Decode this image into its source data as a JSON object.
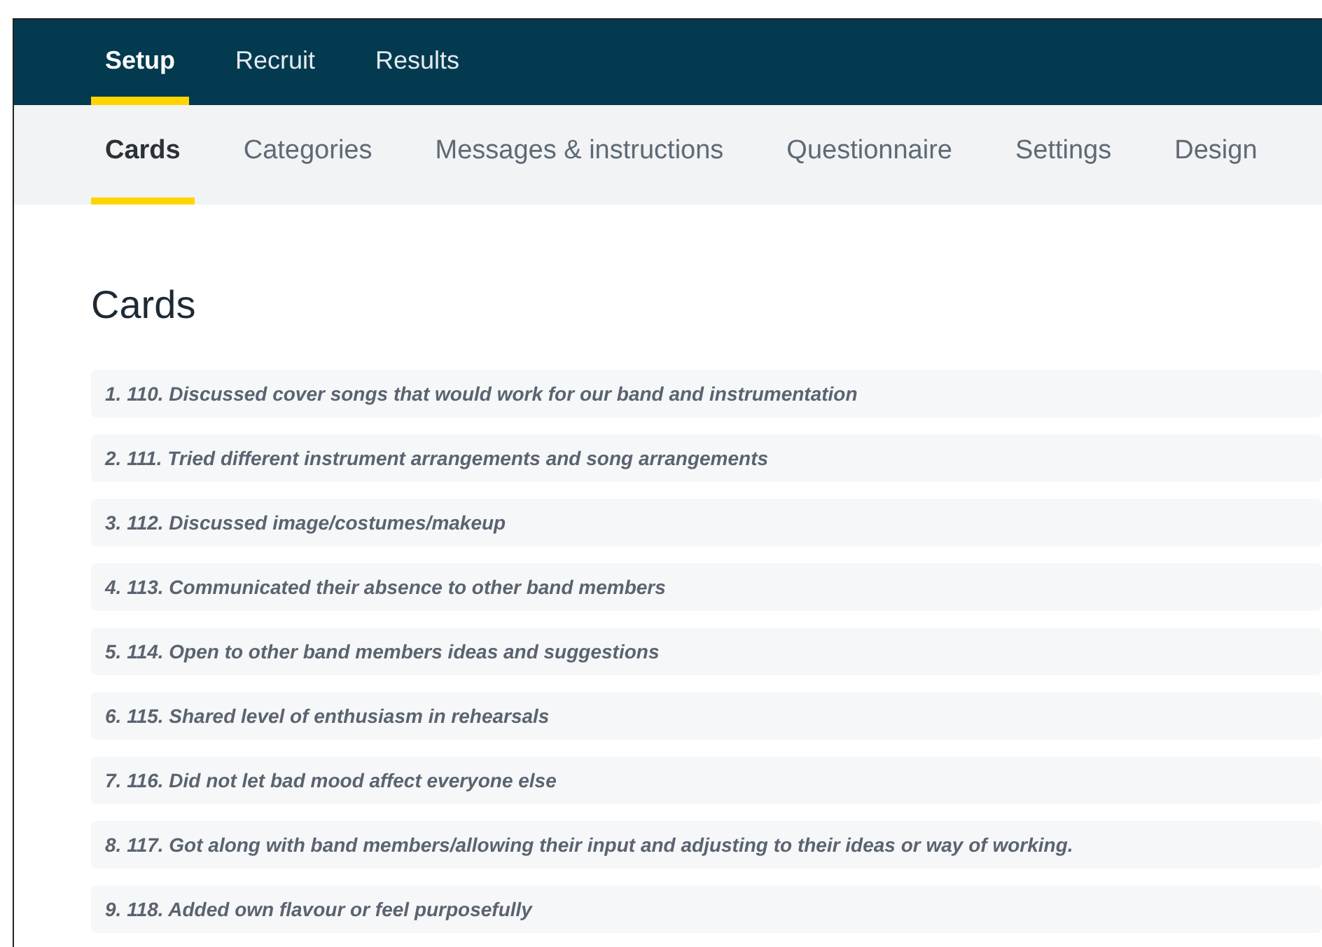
{
  "main_tabs": [
    {
      "label": "Setup",
      "selected": true
    },
    {
      "label": "Recruit",
      "selected": false
    },
    {
      "label": "Results",
      "selected": false
    }
  ],
  "sub_tabs": [
    {
      "label": "Cards",
      "selected": true
    },
    {
      "label": "Categories",
      "selected": false
    },
    {
      "label": "Messages & instructions",
      "selected": false
    },
    {
      "label": "Questionnaire",
      "selected": false
    },
    {
      "label": "Settings",
      "selected": false
    },
    {
      "label": "Design",
      "selected": false
    }
  ],
  "heading": "Cards",
  "cards": [
    "1. 110. Discussed cover songs that would work for our band and instrumentation",
    "2. 111. Tried different instrument arrangements and song arrangements",
    "3. 112. Discussed image/costumes/makeup",
    "4. 113. Communicated their absence to other band members",
    "5. 114. Open to other band members ideas and suggestions",
    "6. 115. Shared level of enthusiasm in rehearsals",
    "7. 116. Did not let bad mood affect everyone else",
    "8. 117. Got along with band members/allowing their input and adjusting to their ideas or way of working.",
    "9. 118. Added own flavour or feel purposefully"
  ]
}
